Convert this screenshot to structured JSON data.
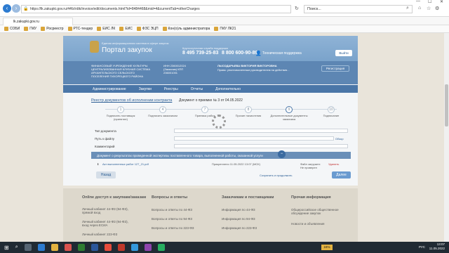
{
  "browser": {
    "url": "https://lk.zakupki.gov.ru/44fz/rdik/invoice/edit/documents.html?id=8484468&mid=4&currentTab=otherCharges",
    "search_placeholder": "Поиск...",
    "tab_title": "lk.zakupki.gov.ru",
    "favorites": [
      "СОБИ",
      "ГМУ",
      "Росреестр",
      "РТС-тендер",
      "ЕИС ЛК",
      "ЕИС",
      "ФЗС ЭЦП",
      "Кон(о)ль администратора",
      "ГМУ ЛК21"
    ]
  },
  "header": {
    "top_text": "Единая информационная система в сфере закупок",
    "portal_title": "Портал закупок",
    "phone_label": "Круглосуточная служба поддержки",
    "phone1": "8 495 739-25-83",
    "phone2": "8 800 600-90-89",
    "support_label": "Техническая поддержка",
    "exit_label": "Выйти"
  },
  "org": {
    "name": "ФИНАНСОВЫЙ УЧРЕЖДЕНИЕ КУЛЬТУРЫ ЦЕНТРАЛИЗОВАННАЯ КЛУБНАЯ СИСТЕМА АРХАНГЕЛЬСКОГО СЕЛЬСКОГО ПОСЕЛЕНИЯ ТИХОРЕЦКОГО РАЙОНА",
    "inn": "ИНН 2360012024 (Заказчик) КПП 236001001",
    "user": "ЛЫСОДАРЬЕВА ВИКТОРИЯ ВИКТОРОВНА",
    "user_info": "Права: уполномоченным руководителем на действия...",
    "register_label": "Регистрация"
  },
  "menu": [
    "Администрирование",
    "Закупки",
    "Реестры",
    "Отчеты",
    "Дополнительно"
  ],
  "breadcrumb": {
    "link": "Реестр документов об исполнении контракта",
    "current": "Документ о приемке № 3 от 04.05.2022"
  },
  "steps": [
    {
      "num": "1",
      "label": "Подписать поставщик (принятие)"
    },
    {
      "num": "4",
      "label": "Подписать заказчиком"
    },
    {
      "num": "7",
      "label": "Приемка работ"
    },
    {
      "num": "8",
      "label": "Прочие начисления"
    },
    {
      "num": "9",
      "label": "Дополнительные документы заказчика"
    },
    {
      "num": "10",
      "label": "Подписание"
    }
  ],
  "form": {
    "type_label": "Тип документа",
    "file_label": "Путь к файлу",
    "comment_label": "Комментарий",
    "browse_label": "Обзор",
    "banner": "Документ о результатах проведенной экспертизы поставленного товара, выполненной работы, оказанной услуги",
    "file_name": "Акт выполненных работ 127_21.pdf",
    "file_date": "Прикреплено 11.05.2022 13:07 (МСК)",
    "file_status": "Файл загружен: Не проверен",
    "delete_label": "Удалить",
    "back_label": "Назад",
    "save_label": "Сохранить и продолжить",
    "next_label": "Далее"
  },
  "footer": {
    "cols": [
      {
        "title": "Online доступ к закупкам/заказам",
        "items": [
          "Личный кабинет 44-ФЗ (94-ФЗ), прямой вход",
          "Личный кабинет 44-ФЗ (94-ФЗ), вход через ЕСИА",
          "Личный кабинет 223-ФЗ"
        ]
      },
      {
        "title": "Вопросы и ответы",
        "items": [
          "Вопросы и ответы по 44-ФЗ",
          "Вопросы и ответы по 94-ФЗ",
          "Вопросы и ответы по 223-ФЗ"
        ]
      },
      {
        "title": "Заказчикам и поставщикам",
        "items": [
          "Информация по 44-ФЗ",
          "Информация по 94-ФЗ",
          "Информация по 223-ФЗ"
        ]
      },
      {
        "title": "Прочая информация",
        "items": [
          "Общероссийское общественное обсуждение закупок",
          "Новости и объявления"
        ]
      }
    ]
  },
  "taskbar": {
    "time": "13:07",
    "date": "11.05.2022",
    "lang": "РУС",
    "battery": "24%"
  }
}
